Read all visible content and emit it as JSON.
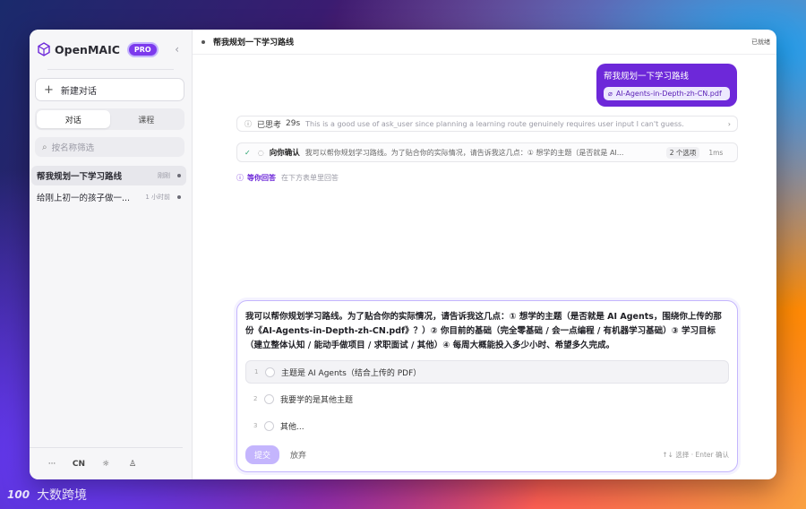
{
  "app": {
    "brand_name": "OpenMAIC",
    "pro_badge": "PRO",
    "brand_color": "#7c3aed"
  },
  "sidebar": {
    "new_chat_label": "新建对话",
    "tabs": [
      {
        "label": "对话",
        "active": true
      },
      {
        "label": "课程",
        "active": false
      }
    ],
    "search_placeholder": "按名称筛选",
    "chats": [
      {
        "title": "帮我规划一下学习路线",
        "time": "刚刚",
        "active": true
      },
      {
        "title": "给刚上初一的孩子做一...",
        "time": "1 小时前",
        "active": false
      }
    ],
    "footer": {
      "more": "···",
      "lang": "CN",
      "theme_icon": "sun-icon",
      "user_icon": "user-icon"
    }
  },
  "topbar": {
    "title": "帮我规划一下学习路线",
    "status": "已就绪"
  },
  "conversation": {
    "user_message": "帮我规划一下学习路线",
    "attachment": "AI-Agents-in-Depth-zh-CN.pdf",
    "thinking": {
      "label": "已思考",
      "duration": "29s",
      "preview": "This is a good use of ask_user since planning a learning route genuinely requires user input I can't guess."
    },
    "tool_call": {
      "name": "向你确认",
      "desc": "我可以帮你规划学习路线。为了贴合你的实际情况，请告诉我这几点：① 想学的主题（是否就是 AI...",
      "options_badge": "2 个选项",
      "duration": "1ms"
    },
    "waiting": {
      "label": "等你回答",
      "hint": "在下方表单里回答"
    }
  },
  "ask_panel": {
    "question": "我可以帮你规划学习路线。为了贴合你的实际情况，请告诉我这几点：① 想学的主题（是否就是 AI Agents，围绕你上传的那份《AI-Agents-in-Depth-zh-CN.pdf》？）② 你目前的基础（完全零基础 / 会一点编程 / 有机器学习基础）③ 学习目标（建立整体认知 / 能动手做项目 / 求职面试 / 其他）④ 每周大概能投入多少小时、希望多久完成。",
    "options": [
      {
        "num": "1",
        "label": "主题是 AI Agents（结合上传的 PDF）"
      },
      {
        "num": "2",
        "label": "我要学的是其他主题"
      },
      {
        "num": "3",
        "label": "其他..."
      }
    ],
    "submit_label": "提交",
    "discard_label": "放弃",
    "key_hint": "↑↓ 选择 · Enter 确认"
  },
  "watermark": {
    "logo": "100",
    "text": "大数跨境"
  }
}
